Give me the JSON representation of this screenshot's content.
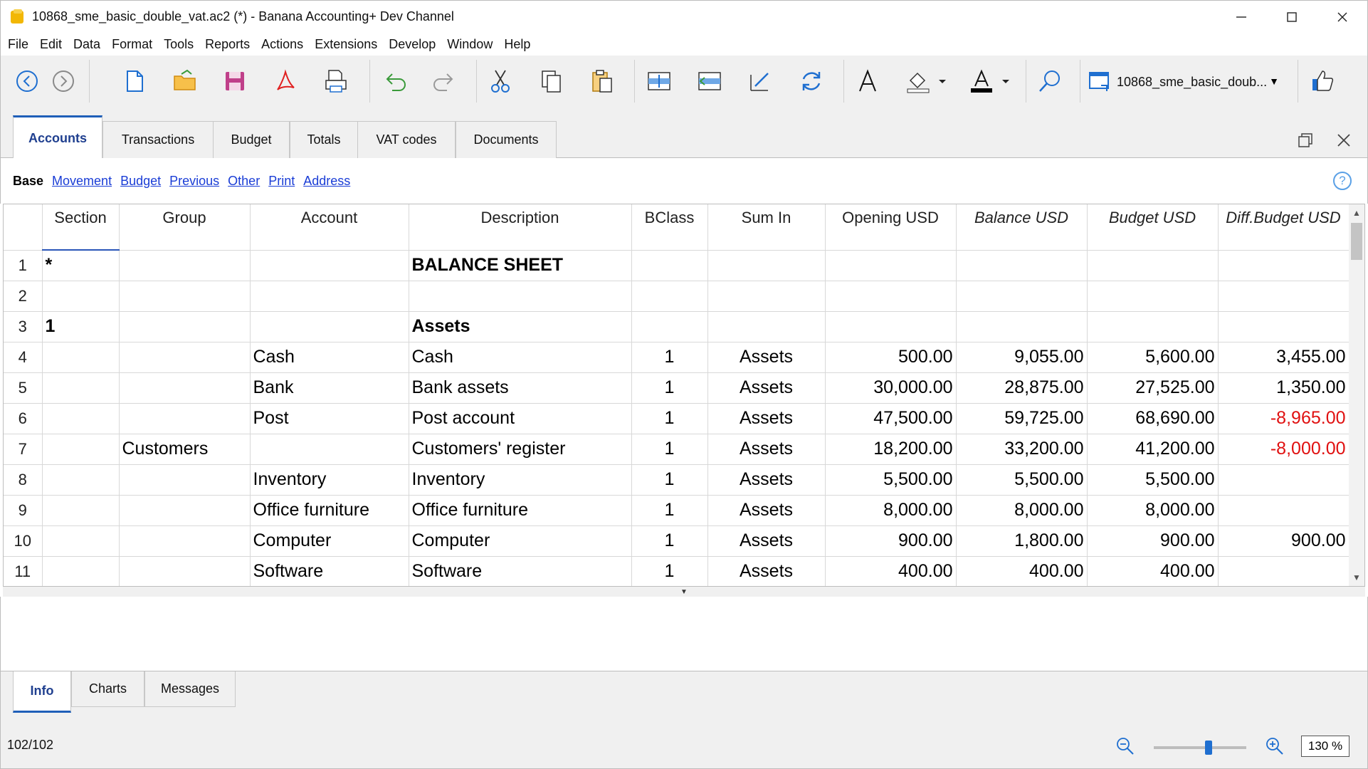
{
  "window": {
    "title": "10868_sme_basic_double_vat.ac2 (*) - Banana Accounting+ Dev Channel",
    "minimize": "—",
    "maximize": "☐",
    "close": "✕"
  },
  "menu": [
    "File",
    "Edit",
    "Data",
    "Format",
    "Tools",
    "Reports",
    "Actions",
    "Extensions",
    "Develop",
    "Window",
    "Help"
  ],
  "toolbar": {
    "file_combo": "10868_sme_basic_doub...",
    "icons": [
      "back-icon",
      "forward-icon",
      "new-file-icon",
      "open-folder-icon",
      "save-icon",
      "pdf-icon",
      "print-preview-icon",
      "undo-icon",
      "redo-icon",
      "cut-icon",
      "copy-icon",
      "paste-icon",
      "insert-row-icon",
      "move-row-icon",
      "edit-icon",
      "recheck-icon",
      "font-icon",
      "fill-color-icon",
      "text-color-icon",
      "find-icon",
      "window-icon",
      "thumbs-up-icon"
    ],
    "accent": "#1f6fd0"
  },
  "tabs": [
    "Accounts",
    "Transactions",
    "Budget",
    "Totals",
    "VAT codes",
    "Documents"
  ],
  "active_tab": "Accounts",
  "views": {
    "active": "Base",
    "links": [
      "Movement",
      "Budget",
      "Previous",
      "Other",
      "Print",
      "Address"
    ]
  },
  "table": {
    "columns": [
      "Section",
      "Group",
      "Account",
      "Description",
      "BClass",
      "Sum In",
      "Opening USD",
      "Balance USD",
      "Budget USD",
      "Diff.Budget USD"
    ],
    "rows": [
      {
        "n": "1",
        "section": "*",
        "group": "",
        "account": "",
        "description": "BALANCE SHEET",
        "bclass": "",
        "sumin": "",
        "opening": "",
        "balance": "",
        "budget": "",
        "diff": ""
      },
      {
        "n": "2",
        "section": "",
        "group": "",
        "account": "",
        "description": "",
        "bclass": "",
        "sumin": "",
        "opening": "",
        "balance": "",
        "budget": "",
        "diff": ""
      },
      {
        "n": "3",
        "section": "1",
        "group": "",
        "account": "",
        "description": "Assets",
        "bclass": "",
        "sumin": "",
        "opening": "",
        "balance": "",
        "budget": "",
        "diff": ""
      },
      {
        "n": "4",
        "section": "",
        "group": "",
        "account": "Cash",
        "description": "Cash",
        "bclass": "1",
        "sumin": "Assets",
        "opening": "500.00",
        "balance": "9,055.00",
        "budget": "5,600.00",
        "diff": "3,455.00"
      },
      {
        "n": "5",
        "section": "",
        "group": "",
        "account": "Bank",
        "description": "Bank assets",
        "bclass": "1",
        "sumin": "Assets",
        "opening": "30,000.00",
        "balance": "28,875.00",
        "budget": "27,525.00",
        "diff": "1,350.00"
      },
      {
        "n": "6",
        "section": "",
        "group": "",
        "account": "Post",
        "description": "Post account",
        "bclass": "1",
        "sumin": "Assets",
        "opening": "47,500.00",
        "balance": "59,725.00",
        "budget": "68,690.00",
        "diff": "-8,965.00"
      },
      {
        "n": "7",
        "section": "",
        "group": "Customers",
        "account": "",
        "description": "Customers' register",
        "bclass": "1",
        "sumin": "Assets",
        "opening": "18,200.00",
        "balance": "33,200.00",
        "budget": "41,200.00",
        "diff": "-8,000.00"
      },
      {
        "n": "8",
        "section": "",
        "group": "",
        "account": "Inventory",
        "description": "Inventory",
        "bclass": "1",
        "sumin": "Assets",
        "opening": "5,500.00",
        "balance": "5,500.00",
        "budget": "5,500.00",
        "diff": ""
      },
      {
        "n": "9",
        "section": "",
        "group": "",
        "account": "Office furniture",
        "description": "Office furniture",
        "bclass": "1",
        "sumin": "Assets",
        "opening": "8,000.00",
        "balance": "8,000.00",
        "budget": "8,000.00",
        "diff": ""
      },
      {
        "n": "10",
        "section": "",
        "group": "",
        "account": "Computer",
        "description": "Computer",
        "bclass": "1",
        "sumin": "Assets",
        "opening": "900.00",
        "balance": "1,800.00",
        "budget": "900.00",
        "diff": "900.00"
      },
      {
        "n": "11",
        "section": "",
        "group": "",
        "account": "Software",
        "description": "Software",
        "bclass": "1",
        "sumin": "Assets",
        "opening": "400.00",
        "balance": "400.00",
        "budget": "400.00",
        "diff": ""
      }
    ],
    "negative_color": "#e01010"
  },
  "bottom_tabs": [
    "Info",
    "Charts",
    "Messages"
  ],
  "status": {
    "row_count": "102/102",
    "zoom": "130 %",
    "zoom_level": 0.6
  }
}
